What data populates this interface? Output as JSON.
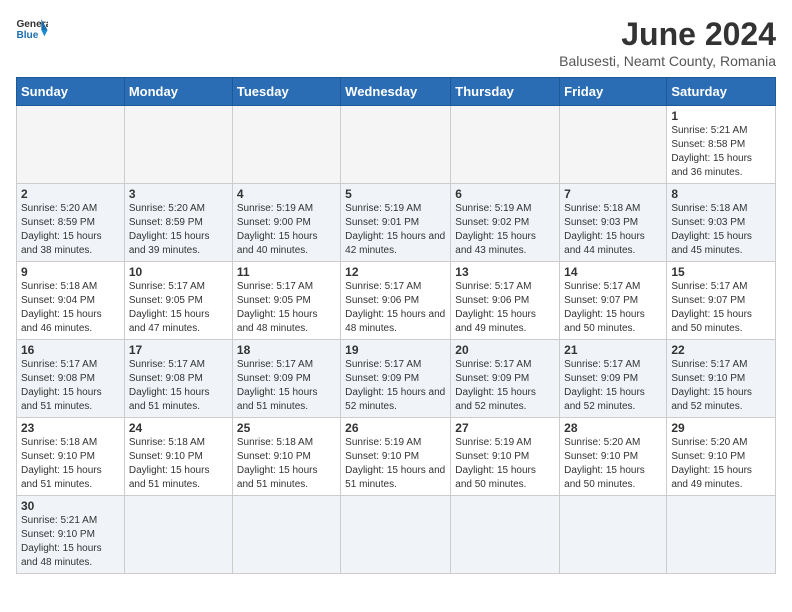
{
  "logo": {
    "text_general": "General",
    "text_blue": "Blue"
  },
  "title": "June 2024",
  "subtitle": "Balusesti, Neamt County, Romania",
  "days_of_week": [
    "Sunday",
    "Monday",
    "Tuesday",
    "Wednesday",
    "Thursday",
    "Friday",
    "Saturday"
  ],
  "weeks": [
    [
      {
        "day": "",
        "info": ""
      },
      {
        "day": "",
        "info": ""
      },
      {
        "day": "",
        "info": ""
      },
      {
        "day": "",
        "info": ""
      },
      {
        "day": "",
        "info": ""
      },
      {
        "day": "",
        "info": ""
      },
      {
        "day": "1",
        "info": "Sunrise: 5:21 AM\nSunset: 8:58 PM\nDaylight: 15 hours and 36 minutes."
      }
    ],
    [
      {
        "day": "2",
        "info": "Sunrise: 5:20 AM\nSunset: 8:59 PM\nDaylight: 15 hours and 38 minutes."
      },
      {
        "day": "3",
        "info": "Sunrise: 5:20 AM\nSunset: 8:59 PM\nDaylight: 15 hours and 39 minutes."
      },
      {
        "day": "4",
        "info": "Sunrise: 5:19 AM\nSunset: 9:00 PM\nDaylight: 15 hours and 40 minutes."
      },
      {
        "day": "5",
        "info": "Sunrise: 5:19 AM\nSunset: 9:01 PM\nDaylight: 15 hours and 42 minutes."
      },
      {
        "day": "6",
        "info": "Sunrise: 5:19 AM\nSunset: 9:02 PM\nDaylight: 15 hours and 43 minutes."
      },
      {
        "day": "7",
        "info": "Sunrise: 5:18 AM\nSunset: 9:03 PM\nDaylight: 15 hours and 44 minutes."
      },
      {
        "day": "8",
        "info": "Sunrise: 5:18 AM\nSunset: 9:03 PM\nDaylight: 15 hours and 45 minutes."
      }
    ],
    [
      {
        "day": "9",
        "info": "Sunrise: 5:18 AM\nSunset: 9:04 PM\nDaylight: 15 hours and 46 minutes."
      },
      {
        "day": "10",
        "info": "Sunrise: 5:17 AM\nSunset: 9:05 PM\nDaylight: 15 hours and 47 minutes."
      },
      {
        "day": "11",
        "info": "Sunrise: 5:17 AM\nSunset: 9:05 PM\nDaylight: 15 hours and 48 minutes."
      },
      {
        "day": "12",
        "info": "Sunrise: 5:17 AM\nSunset: 9:06 PM\nDaylight: 15 hours and 48 minutes."
      },
      {
        "day": "13",
        "info": "Sunrise: 5:17 AM\nSunset: 9:06 PM\nDaylight: 15 hours and 49 minutes."
      },
      {
        "day": "14",
        "info": "Sunrise: 5:17 AM\nSunset: 9:07 PM\nDaylight: 15 hours and 50 minutes."
      },
      {
        "day": "15",
        "info": "Sunrise: 5:17 AM\nSunset: 9:07 PM\nDaylight: 15 hours and 50 minutes."
      }
    ],
    [
      {
        "day": "16",
        "info": "Sunrise: 5:17 AM\nSunset: 9:08 PM\nDaylight: 15 hours and 51 minutes."
      },
      {
        "day": "17",
        "info": "Sunrise: 5:17 AM\nSunset: 9:08 PM\nDaylight: 15 hours and 51 minutes."
      },
      {
        "day": "18",
        "info": "Sunrise: 5:17 AM\nSunset: 9:09 PM\nDaylight: 15 hours and 51 minutes."
      },
      {
        "day": "19",
        "info": "Sunrise: 5:17 AM\nSunset: 9:09 PM\nDaylight: 15 hours and 52 minutes."
      },
      {
        "day": "20",
        "info": "Sunrise: 5:17 AM\nSunset: 9:09 PM\nDaylight: 15 hours and 52 minutes."
      },
      {
        "day": "21",
        "info": "Sunrise: 5:17 AM\nSunset: 9:09 PM\nDaylight: 15 hours and 52 minutes."
      },
      {
        "day": "22",
        "info": "Sunrise: 5:17 AM\nSunset: 9:10 PM\nDaylight: 15 hours and 52 minutes."
      }
    ],
    [
      {
        "day": "23",
        "info": "Sunrise: 5:18 AM\nSunset: 9:10 PM\nDaylight: 15 hours and 51 minutes."
      },
      {
        "day": "24",
        "info": "Sunrise: 5:18 AM\nSunset: 9:10 PM\nDaylight: 15 hours and 51 minutes."
      },
      {
        "day": "25",
        "info": "Sunrise: 5:18 AM\nSunset: 9:10 PM\nDaylight: 15 hours and 51 minutes."
      },
      {
        "day": "26",
        "info": "Sunrise: 5:19 AM\nSunset: 9:10 PM\nDaylight: 15 hours and 51 minutes."
      },
      {
        "day": "27",
        "info": "Sunrise: 5:19 AM\nSunset: 9:10 PM\nDaylight: 15 hours and 50 minutes."
      },
      {
        "day": "28",
        "info": "Sunrise: 5:20 AM\nSunset: 9:10 PM\nDaylight: 15 hours and 50 minutes."
      },
      {
        "day": "29",
        "info": "Sunrise: 5:20 AM\nSunset: 9:10 PM\nDaylight: 15 hours and 49 minutes."
      }
    ],
    [
      {
        "day": "30",
        "info": "Sunrise: 5:21 AM\nSunset: 9:10 PM\nDaylight: 15 hours and 48 minutes."
      },
      {
        "day": "",
        "info": ""
      },
      {
        "day": "",
        "info": ""
      },
      {
        "day": "",
        "info": ""
      },
      {
        "day": "",
        "info": ""
      },
      {
        "day": "",
        "info": ""
      },
      {
        "day": "",
        "info": ""
      }
    ]
  ]
}
